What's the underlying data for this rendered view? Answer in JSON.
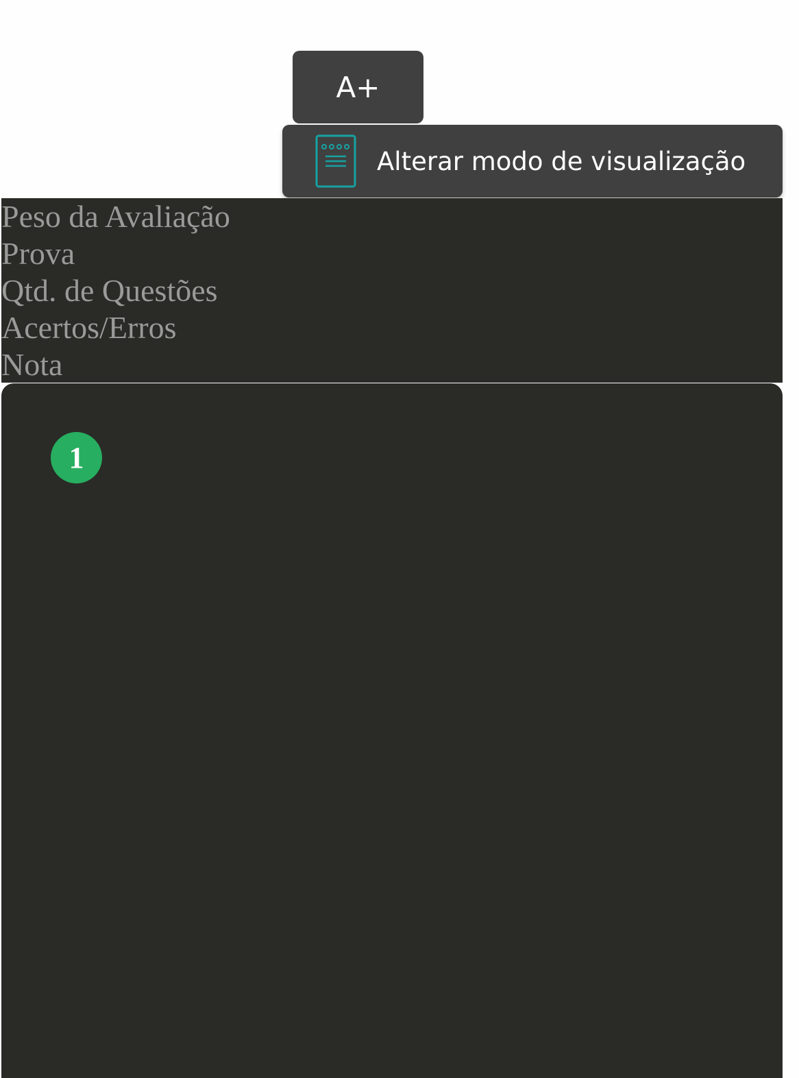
{
  "toolbar": {
    "font_increase_label": "A+",
    "view_mode_label": "Alterar modo de visualização",
    "view_mode_icon": "document-icon",
    "icon_color": "#17a2a2"
  },
  "info": {
    "rows": [
      "Peso da Avaliação",
      "Prova",
      "Qtd. de Questões",
      "Acertos/Erros",
      "Nota"
    ]
  },
  "question": {
    "number": "1",
    "badge_color": "#27ae60"
  }
}
